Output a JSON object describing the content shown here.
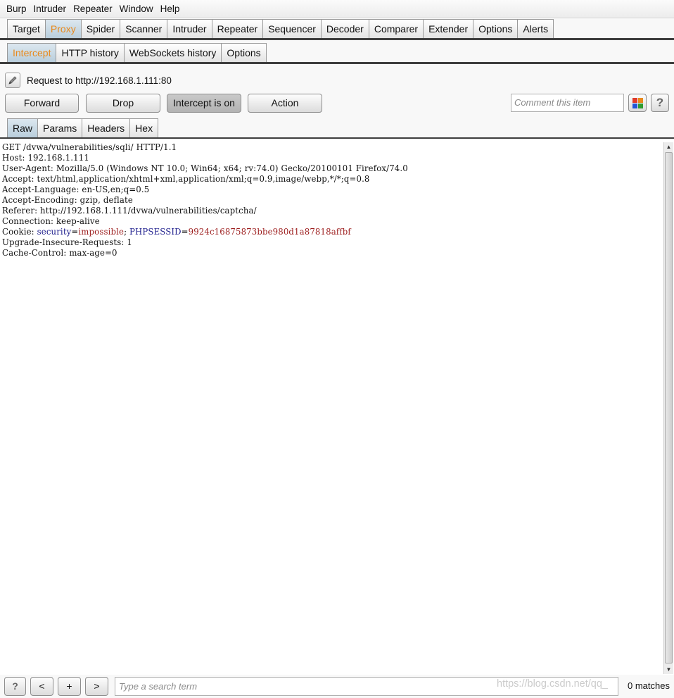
{
  "menu": [
    "Burp",
    "Intruder",
    "Repeater",
    "Window",
    "Help"
  ],
  "main_tabs": [
    "Target",
    "Proxy",
    "Spider",
    "Scanner",
    "Intruder",
    "Repeater",
    "Sequencer",
    "Decoder",
    "Comparer",
    "Extender",
    "Options",
    "Alerts"
  ],
  "proxy_tabs": [
    "Intercept",
    "HTTP history",
    "WebSockets history",
    "Options"
  ],
  "request_to": "Request to http://192.168.1.111:80",
  "buttons": {
    "forward": "Forward",
    "drop": "Drop",
    "intercept": "Intercept is on",
    "action": "Action"
  },
  "comment_placeholder": "Comment this item",
  "help_glyph": "?",
  "view_tabs": [
    "Raw",
    "Params",
    "Headers",
    "Hex"
  ],
  "request_lines": [
    "GET /dvwa/vulnerabilities/sqli/ HTTP/1.1",
    "Host: 192.168.1.111",
    "User-Agent: Mozilla/5.0 (Windows NT 10.0; Win64; x64; rv:74.0) Gecko/20100101 Firefox/74.0",
    "Accept: text/html,application/xhtml+xml,application/xml;q=0.9,image/webp,*/*;q=0.8",
    "Accept-Language: en-US,en;q=0.5",
    "Accept-Encoding: gzip, deflate",
    "Referer: http://192.168.1.111/dvwa/vulnerabilities/captcha/"
  ],
  "connection_line": "Connection: keep-alive",
  "cookie": {
    "prefix": "Cookie: ",
    "k1": "security",
    "eq1": "=",
    "v1": "impossible",
    "sep": "; ",
    "k2": "PHPSESSID",
    "eq2": "=",
    "v2": "9924c16875873bbe980d1a87818affbf"
  },
  "request_lines_tail": [
    "Upgrade-Insecure-Requests: 1",
    "Cache-Control: max-age=0"
  ],
  "bottom": {
    "help": "?",
    "prev": "<",
    "add": "+",
    "next": ">",
    "search_placeholder": "Type a search term",
    "matches": "0 matches"
  },
  "watermark": "https://blog.csdn.net/qq_",
  "colors": {
    "active_tab_text": "#e8891c",
    "cookie_key": "#1c1c8c",
    "cookie_value": "#9c1c1c"
  }
}
